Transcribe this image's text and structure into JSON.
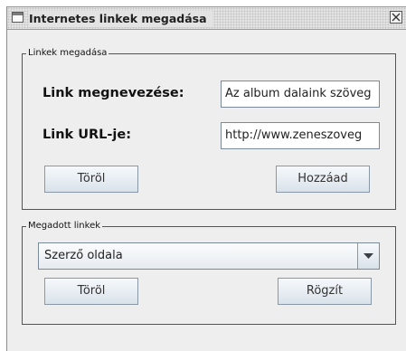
{
  "window": {
    "title": "Internetes linkek megadása"
  },
  "link_group": {
    "legend": "Linkek megadása",
    "name_label": "Link megnevezése:",
    "name_value": "Az album dalaink szöveg",
    "url_label": "Link URL-je:",
    "url_value": "http://www.zeneszoveg",
    "delete_button": "Töröl",
    "add_button": "Hozzáad"
  },
  "links_group": {
    "legend": "Megadott linkek",
    "selected_link": "Szerző oldala",
    "delete_button": "Töröl",
    "save_button": "Rögzít"
  },
  "icons": {
    "window_icon": "window-icon",
    "close": "close-icon",
    "dropdown": "chevron-down-icon"
  }
}
